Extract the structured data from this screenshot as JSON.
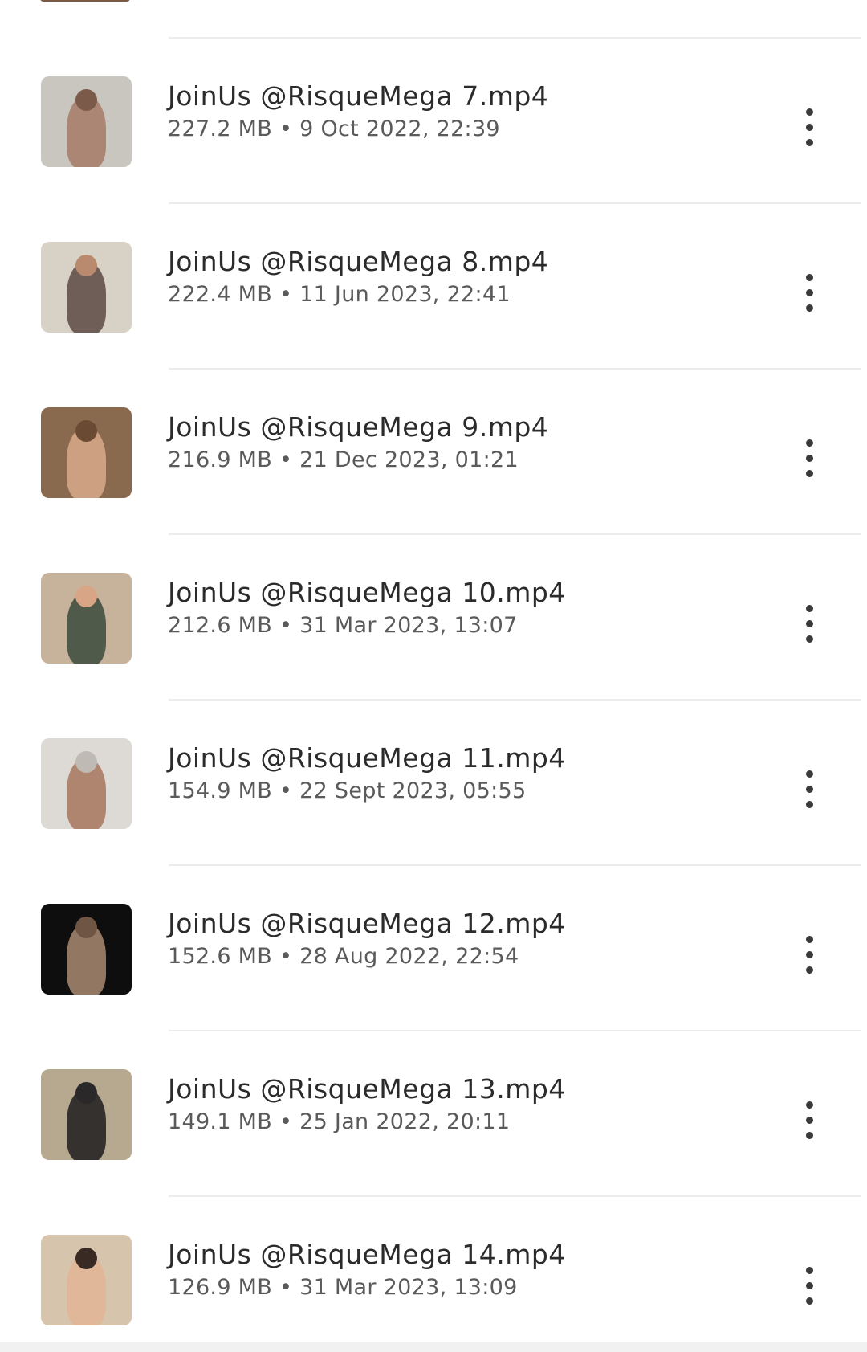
{
  "files": [
    {
      "name": "JoinUs @RisqueMega 7.mp4",
      "meta": "227.2 MB • 9 Oct 2022, 22:39",
      "thumb_bg": "#c9c6bf",
      "thumb_fig": "#a77a66",
      "thumb_head": "#7b5a4a"
    },
    {
      "name": "JoinUs @RisqueMega 8.mp4",
      "meta": "222.4 MB • 11 Jun 2023, 22:41",
      "thumb_bg": "#d7d1c6",
      "thumb_fig": "#5d4a43",
      "thumb_head": "#b98a6d"
    },
    {
      "name": "JoinUs @RisqueMega 9.mp4",
      "meta": "216.9 MB • 21 Dec 2023, 01:21",
      "thumb_bg": "#8a6a4f",
      "thumb_fig": "#d9a98b",
      "thumb_head": "#6b4a33"
    },
    {
      "name": "JoinUs @RisqueMega 10.mp4",
      "meta": "212.6 MB • 31 Mar 2023, 13:07",
      "thumb_bg": "#c7b29c",
      "thumb_fig": "#3b4a3d",
      "thumb_head": "#d8a586"
    },
    {
      "name": "JoinUs @RisqueMega 11.mp4",
      "meta": "154.9 MB • 22 Sept 2023, 05:55",
      "thumb_bg": "#dddad6",
      "thumb_fig": "#a8765d",
      "thumb_head": "#bfbab3"
    },
    {
      "name": "JoinUs @RisqueMega 12.mp4",
      "meta": "152.6 MB • 28 Aug 2022, 22:54",
      "thumb_bg": "#0e0e0e",
      "thumb_fig": "#a98a72",
      "thumb_head": "#6e5544"
    },
    {
      "name": "JoinUs @RisqueMega 13.mp4",
      "meta": "149.1 MB • 25 Jan 2022, 20:11",
      "thumb_bg": "#b7a98f",
      "thumb_fig": "#1e1c1d",
      "thumb_head": "#2a2828"
    },
    {
      "name": "JoinUs @RisqueMega 14.mp4",
      "meta": "126.9 MB • 31 Mar 2023, 13:09",
      "thumb_bg": "#d6c4ad",
      "thumb_fig": "#e2b595",
      "thumb_head": "#3a2a24"
    }
  ],
  "icons": {
    "more": "more-vert-icon"
  },
  "colors": {
    "background": "#ffffff",
    "divider": "#ececec",
    "title_text": "#2b2b2b",
    "meta_text": "#5a5a5a",
    "icon": "#3a3a3a"
  }
}
